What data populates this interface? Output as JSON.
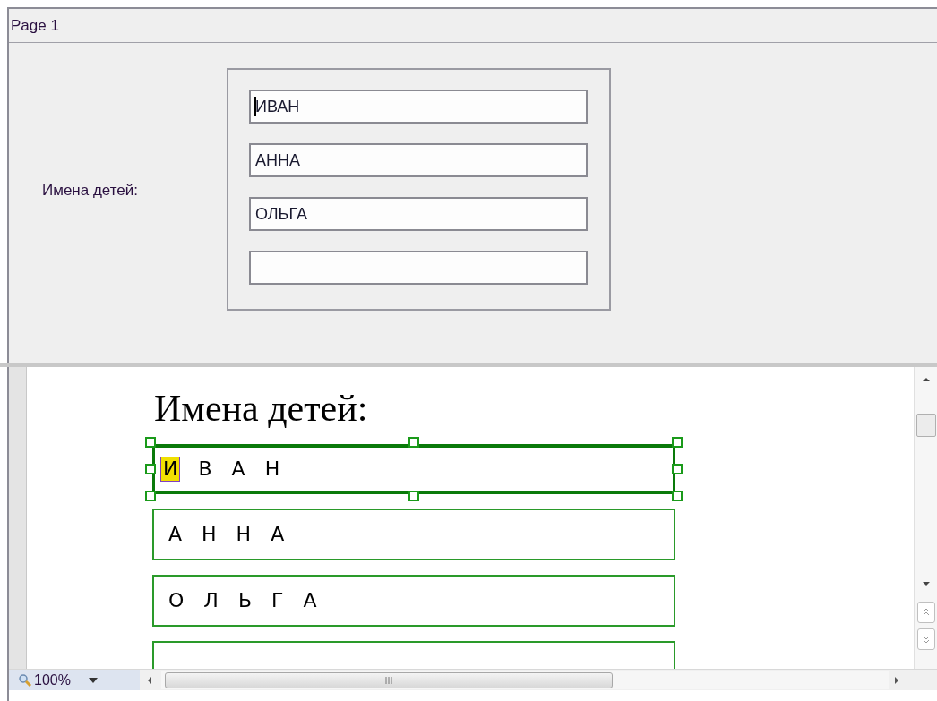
{
  "page_tab": {
    "title": "Page 1"
  },
  "form": {
    "label": "Имена детей:",
    "fields": [
      {
        "value": "ИВАН",
        "focused": true
      },
      {
        "value": "АННА",
        "focused": false
      },
      {
        "value": "ОЛЬГА",
        "focused": false
      },
      {
        "focused": false
      }
    ]
  },
  "document": {
    "heading": "Имена детей:",
    "boxes": [
      {
        "selected": true,
        "letters": [
          {
            "char": "И",
            "highlighted": true
          },
          {
            "char": "В",
            "highlighted": false
          },
          {
            "char": "А",
            "highlighted": false
          },
          {
            "char": "Н",
            "highlighted": false
          }
        ]
      },
      {
        "selected": false,
        "letters": [
          {
            "char": "А",
            "highlighted": false
          },
          {
            "char": "Н",
            "highlighted": false
          },
          {
            "char": "Н",
            "highlighted": false
          },
          {
            "char": "А",
            "highlighted": false
          }
        ]
      },
      {
        "selected": false,
        "letters": [
          {
            "char": "О",
            "highlighted": false
          },
          {
            "char": "Л",
            "highlighted": false
          },
          {
            "char": "Ь",
            "highlighted": false
          },
          {
            "char": "Г",
            "highlighted": false
          },
          {
            "char": "А",
            "highlighted": false
          }
        ]
      },
      {
        "selected": false
      }
    ]
  },
  "status_bar": {
    "zoom": "100%"
  }
}
